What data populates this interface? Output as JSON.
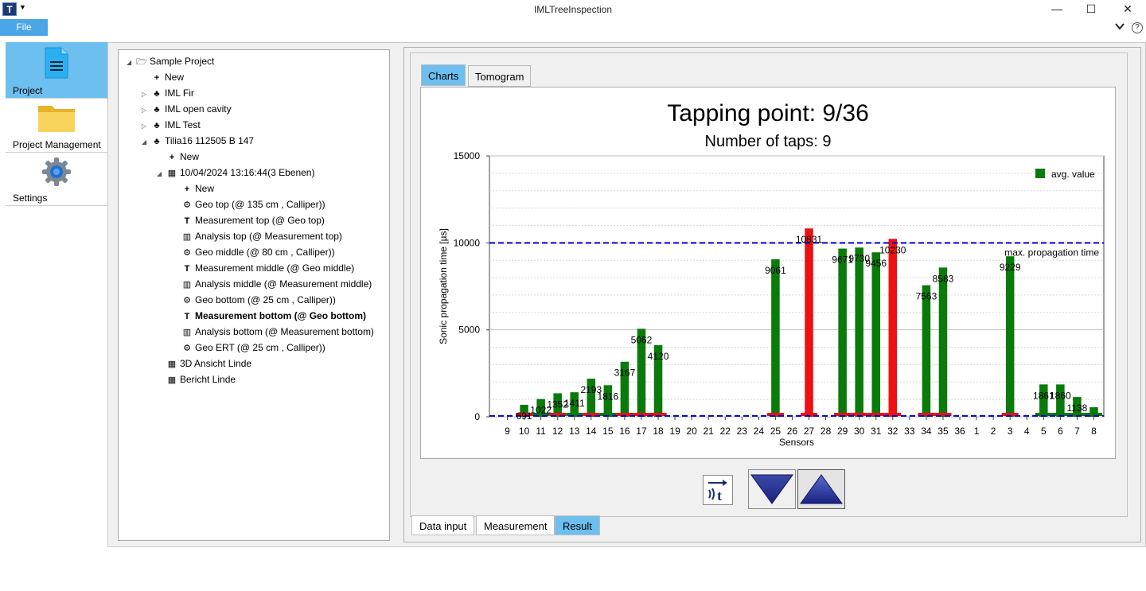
{
  "window": {
    "title": "IMLTreeInspection",
    "app_icon": "T"
  },
  "menu": {
    "file_label": "File"
  },
  "nav": {
    "items": [
      {
        "label": "Project",
        "icon": "document-icon"
      },
      {
        "label": "Project Management",
        "icon": "folder-icon"
      },
      {
        "label": "Settings",
        "icon": "gear-icon"
      }
    ]
  },
  "tree": {
    "root": "Sample Project",
    "new1": "New",
    "fir": "IML Fir",
    "cavity": "IML open cavity",
    "test": "IML Test",
    "tilia": "Tilia16 112505 B 147",
    "new2": "New",
    "session": "10/04/2024 13:16:44(3 Ebenen)",
    "new3": "New",
    "geo_top": "Geo top (@ 135 cm , Calliper))",
    "meas_top": "Measurement top (@ Geo top)",
    "ana_top": "Analysis top (@ Measurement top)",
    "geo_mid": "Geo middle (@ 80 cm , Calliper))",
    "meas_mid": "Measurement middle (@ Geo middle)",
    "ana_mid": "Analysis middle (@ Measurement middle)",
    "geo_bot": "Geo bottom (@ 25 cm , Calliper))",
    "meas_bot": "Measurement bottom (@ Geo bottom)",
    "ana_bot": "Analysis bottom (@ Measurement bottom)",
    "geo_ert": "Geo ERT (@ 25 cm , Calliper))",
    "ansicht": "3D Ansicht Linde",
    "bericht": "Bericht Linde"
  },
  "tabs": {
    "charts": "Charts",
    "tomogram": "Tomogram"
  },
  "bottom_tabs": {
    "data_input": "Data input",
    "measurement": "Measurement",
    "result": "Result"
  },
  "colors": {
    "green": "#0a7a0a",
    "red": "#ee1111",
    "accent": "#6cbfef",
    "line": "#0000cc"
  },
  "chart_data": {
    "type": "bar",
    "title": "Tapping point: 9/36",
    "subtitle": "Number of taps: 9",
    "xlabel": "Sensors",
    "ylabel": "Sonic propagation time [µs]",
    "ylim": [
      0,
      15000
    ],
    "yticks": [
      0,
      5000,
      10000,
      15000
    ],
    "legend": "avg. value",
    "legend_position": "top-right",
    "reference_line_label": "max. propagation time",
    "reference_line_value": 10000,
    "min_line_value": 50,
    "categories": [
      "9",
      "10",
      "11",
      "12",
      "13",
      "14",
      "15",
      "16",
      "17",
      "18",
      "19",
      "20",
      "21",
      "22",
      "23",
      "24",
      "25",
      "26",
      "27",
      "28",
      "29",
      "30",
      "31",
      "32",
      "33",
      "34",
      "35",
      "36",
      "1",
      "2",
      "3",
      "4",
      "5",
      "6",
      "7",
      "8"
    ],
    "values": [
      0,
      691,
      1022,
      1352,
      1411,
      2193,
      1816,
      3167,
      5062,
      4120,
      0,
      0,
      0,
      0,
      0,
      0,
      9061,
      0,
      10831,
      0,
      9671,
      9730,
      9456,
      10230,
      0,
      7563,
      8583,
      0,
      0,
      0,
      9229,
      0,
      1861,
      1860,
      1138,
      550
    ],
    "bar_colors": [
      "g",
      "g",
      "g",
      "g",
      "g",
      "g",
      "g",
      "g",
      "g",
      "g",
      "g",
      "g",
      "g",
      "g",
      "g",
      "g",
      "g",
      "g",
      "r",
      "g",
      "g",
      "g",
      "g",
      "r",
      "g",
      "g",
      "g",
      "g",
      "g",
      "g",
      "g",
      "g",
      "g",
      "g",
      "g",
      "g"
    ],
    "data_labels": [
      "",
      "691",
      "1022",
      "1352",
      "1411",
      "2193",
      "1816",
      "3167",
      "5062",
      "4120",
      "",
      "",
      "",
      "",
      "",
      "",
      "9061",
      "",
      "10831",
      "",
      "9671",
      "9730",
      "9456",
      "10230",
      "",
      "7563",
      "8583",
      "",
      "",
      "",
      "9229",
      "",
      "1861",
      "1860",
      "1138",
      ""
    ],
    "baseline_colors": [
      "n",
      "r",
      "g",
      "r",
      "g",
      "r",
      "g",
      "r",
      "r",
      "r",
      "n",
      "n",
      "n",
      "n",
      "n",
      "n",
      "r",
      "n",
      "r",
      "n",
      "r",
      "r",
      "r",
      "r",
      "n",
      "r",
      "r",
      "n",
      "n",
      "n",
      "r",
      "n",
      "g",
      "g",
      "g",
      "g"
    ]
  }
}
